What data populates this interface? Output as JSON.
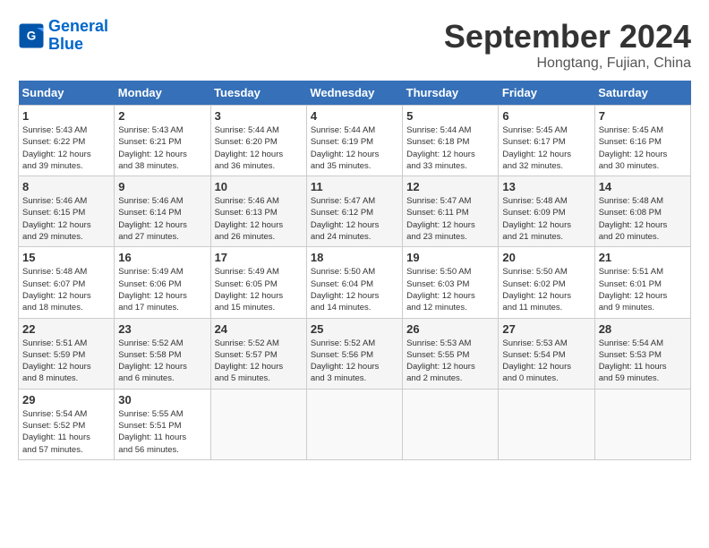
{
  "header": {
    "logo_line1": "General",
    "logo_line2": "Blue",
    "month": "September 2024",
    "location": "Hongtang, Fujian, China"
  },
  "weekdays": [
    "Sunday",
    "Monday",
    "Tuesday",
    "Wednesday",
    "Thursday",
    "Friday",
    "Saturday"
  ],
  "weeks": [
    [
      {
        "day": "1",
        "info": "Sunrise: 5:43 AM\nSunset: 6:22 PM\nDaylight: 12 hours\nand 39 minutes."
      },
      {
        "day": "2",
        "info": "Sunrise: 5:43 AM\nSunset: 6:21 PM\nDaylight: 12 hours\nand 38 minutes."
      },
      {
        "day": "3",
        "info": "Sunrise: 5:44 AM\nSunset: 6:20 PM\nDaylight: 12 hours\nand 36 minutes."
      },
      {
        "day": "4",
        "info": "Sunrise: 5:44 AM\nSunset: 6:19 PM\nDaylight: 12 hours\nand 35 minutes."
      },
      {
        "day": "5",
        "info": "Sunrise: 5:44 AM\nSunset: 6:18 PM\nDaylight: 12 hours\nand 33 minutes."
      },
      {
        "day": "6",
        "info": "Sunrise: 5:45 AM\nSunset: 6:17 PM\nDaylight: 12 hours\nand 32 minutes."
      },
      {
        "day": "7",
        "info": "Sunrise: 5:45 AM\nSunset: 6:16 PM\nDaylight: 12 hours\nand 30 minutes."
      }
    ],
    [
      {
        "day": "8",
        "info": "Sunrise: 5:46 AM\nSunset: 6:15 PM\nDaylight: 12 hours\nand 29 minutes."
      },
      {
        "day": "9",
        "info": "Sunrise: 5:46 AM\nSunset: 6:14 PM\nDaylight: 12 hours\nand 27 minutes."
      },
      {
        "day": "10",
        "info": "Sunrise: 5:46 AM\nSunset: 6:13 PM\nDaylight: 12 hours\nand 26 minutes."
      },
      {
        "day": "11",
        "info": "Sunrise: 5:47 AM\nSunset: 6:12 PM\nDaylight: 12 hours\nand 24 minutes."
      },
      {
        "day": "12",
        "info": "Sunrise: 5:47 AM\nSunset: 6:11 PM\nDaylight: 12 hours\nand 23 minutes."
      },
      {
        "day": "13",
        "info": "Sunrise: 5:48 AM\nSunset: 6:09 PM\nDaylight: 12 hours\nand 21 minutes."
      },
      {
        "day": "14",
        "info": "Sunrise: 5:48 AM\nSunset: 6:08 PM\nDaylight: 12 hours\nand 20 minutes."
      }
    ],
    [
      {
        "day": "15",
        "info": "Sunrise: 5:48 AM\nSunset: 6:07 PM\nDaylight: 12 hours\nand 18 minutes."
      },
      {
        "day": "16",
        "info": "Sunrise: 5:49 AM\nSunset: 6:06 PM\nDaylight: 12 hours\nand 17 minutes."
      },
      {
        "day": "17",
        "info": "Sunrise: 5:49 AM\nSunset: 6:05 PM\nDaylight: 12 hours\nand 15 minutes."
      },
      {
        "day": "18",
        "info": "Sunrise: 5:50 AM\nSunset: 6:04 PM\nDaylight: 12 hours\nand 14 minutes."
      },
      {
        "day": "19",
        "info": "Sunrise: 5:50 AM\nSunset: 6:03 PM\nDaylight: 12 hours\nand 12 minutes."
      },
      {
        "day": "20",
        "info": "Sunrise: 5:50 AM\nSunset: 6:02 PM\nDaylight: 12 hours\nand 11 minutes."
      },
      {
        "day": "21",
        "info": "Sunrise: 5:51 AM\nSunset: 6:01 PM\nDaylight: 12 hours\nand 9 minutes."
      }
    ],
    [
      {
        "day": "22",
        "info": "Sunrise: 5:51 AM\nSunset: 5:59 PM\nDaylight: 12 hours\nand 8 minutes."
      },
      {
        "day": "23",
        "info": "Sunrise: 5:52 AM\nSunset: 5:58 PM\nDaylight: 12 hours\nand 6 minutes."
      },
      {
        "day": "24",
        "info": "Sunrise: 5:52 AM\nSunset: 5:57 PM\nDaylight: 12 hours\nand 5 minutes."
      },
      {
        "day": "25",
        "info": "Sunrise: 5:52 AM\nSunset: 5:56 PM\nDaylight: 12 hours\nand 3 minutes."
      },
      {
        "day": "26",
        "info": "Sunrise: 5:53 AM\nSunset: 5:55 PM\nDaylight: 12 hours\nand 2 minutes."
      },
      {
        "day": "27",
        "info": "Sunrise: 5:53 AM\nSunset: 5:54 PM\nDaylight: 12 hours\nand 0 minutes."
      },
      {
        "day": "28",
        "info": "Sunrise: 5:54 AM\nSunset: 5:53 PM\nDaylight: 11 hours\nand 59 minutes."
      }
    ],
    [
      {
        "day": "29",
        "info": "Sunrise: 5:54 AM\nSunset: 5:52 PM\nDaylight: 11 hours\nand 57 minutes."
      },
      {
        "day": "30",
        "info": "Sunrise: 5:55 AM\nSunset: 5:51 PM\nDaylight: 11 hours\nand 56 minutes."
      },
      {
        "day": "",
        "info": ""
      },
      {
        "day": "",
        "info": ""
      },
      {
        "day": "",
        "info": ""
      },
      {
        "day": "",
        "info": ""
      },
      {
        "day": "",
        "info": ""
      }
    ]
  ]
}
